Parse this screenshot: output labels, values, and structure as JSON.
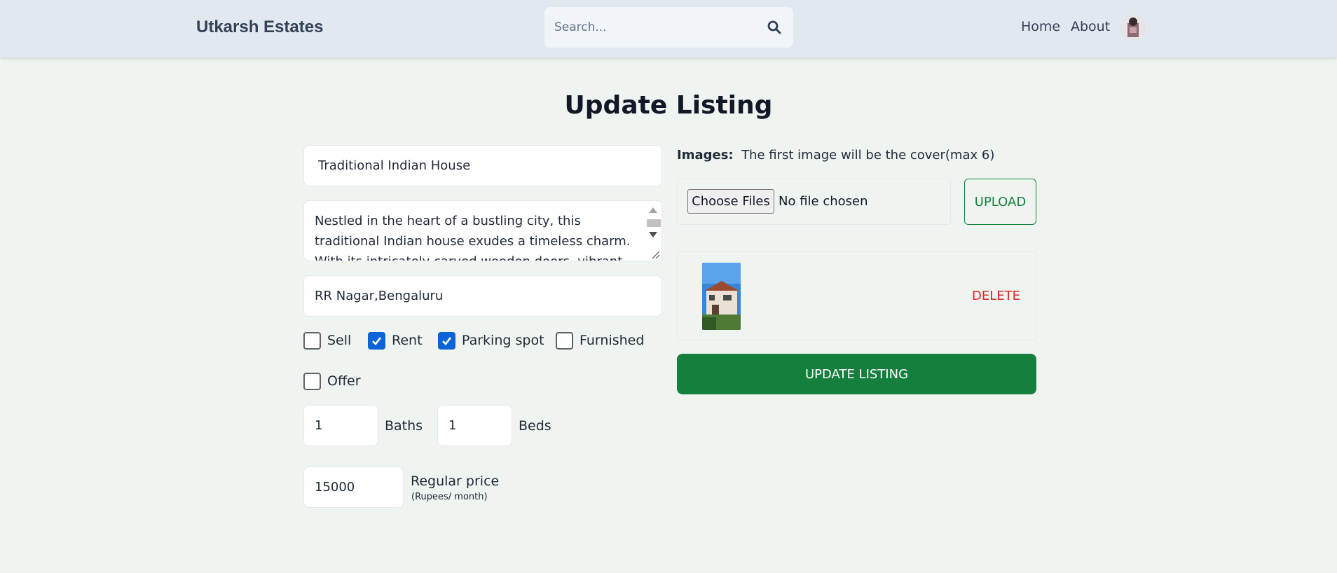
{
  "header": {
    "brand": "Utkarsh Estates",
    "search_placeholder": "Search...",
    "nav": {
      "home": "Home",
      "about": "About"
    }
  },
  "page": {
    "title": "Update Listing"
  },
  "form": {
    "name_value": "Traditional Indian House",
    "description_value": "Nestled in the heart of a bustling city, this traditional Indian house exudes a timeless charm. With its intricately carved wooden doors, vibrant courtyards",
    "address_value": "RR Nagar,Bengaluru",
    "options": [
      {
        "label": "Sell",
        "checked": false
      },
      {
        "label": "Rent",
        "checked": true
      },
      {
        "label": "Parking spot",
        "checked": true
      },
      {
        "label": "Furnished",
        "checked": false
      },
      {
        "label": "Offer",
        "checked": false
      }
    ],
    "baths_value": "1",
    "baths_label": "Baths",
    "beds_value": "1",
    "beds_label": "Beds",
    "price_value": "15000",
    "price_label": "Regular price",
    "price_sub": "(Rupees/ month)"
  },
  "images": {
    "heading_bold": "Images:",
    "heading_note": "The first image will be the cover(max 6)",
    "choose_label": "Choose Files",
    "no_file_label": "No file chosen",
    "upload_label": "UPLOAD",
    "delete_label": "DELETE"
  },
  "actions": {
    "update_label": "UPDATE LISTING"
  },
  "colors": {
    "accent_green": "#15803d",
    "delete_red": "#dc2626",
    "checkbox_blue": "#0b64d8",
    "header_bg": "#e2e8f0",
    "page_bg": "#f0f4f0"
  }
}
